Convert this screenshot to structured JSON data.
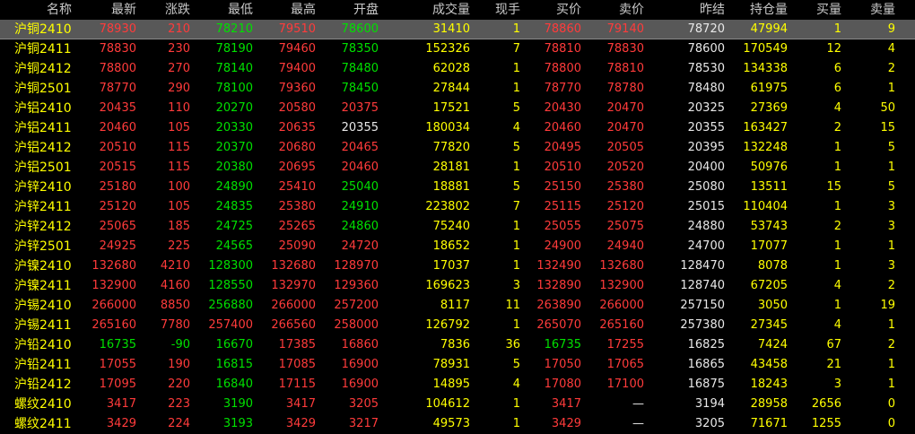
{
  "columns": [
    "名称",
    "最新",
    "涨跌",
    "最低",
    "最高",
    "开盘",
    "成交量",
    "现手",
    "买价",
    "卖价",
    "昨结",
    "持仓量",
    "买量",
    "卖量"
  ],
  "colors": {
    "up": "#ff3b3b",
    "down": "#00e000",
    "name": "#ffff00",
    "neutral": "#e8e8e8",
    "header": "#c8c8c8",
    "selected_row": "#585858"
  },
  "selected_row_index": 0,
  "rows": [
    {
      "name": "沪铜2410",
      "last": "78930",
      "chg": "210",
      "low": "78210",
      "high": "79510",
      "open": "78600",
      "vol": "31410",
      "curvol": "1",
      "bid": "78860",
      "ask": "79140",
      "prev": "78720",
      "oi": "47994",
      "bidvol": "1",
      "askvol": "9"
    },
    {
      "name": "沪铜2411",
      "last": "78830",
      "chg": "230",
      "low": "78190",
      "high": "79460",
      "open": "78350",
      "vol": "152326",
      "curvol": "7",
      "bid": "78810",
      "ask": "78830",
      "prev": "78600",
      "oi": "170549",
      "bidvol": "12",
      "askvol": "4"
    },
    {
      "name": "沪铜2412",
      "last": "78800",
      "chg": "270",
      "low": "78140",
      "high": "79400",
      "open": "78480",
      "vol": "62028",
      "curvol": "1",
      "bid": "78800",
      "ask": "78810",
      "prev": "78530",
      "oi": "134338",
      "bidvol": "6",
      "askvol": "2"
    },
    {
      "name": "沪铜2501",
      "last": "78770",
      "chg": "290",
      "low": "78100",
      "high": "79360",
      "open": "78450",
      "vol": "27844",
      "curvol": "1",
      "bid": "78770",
      "ask": "78780",
      "prev": "78480",
      "oi": "61975",
      "bidvol": "6",
      "askvol": "1"
    },
    {
      "name": "沪铝2410",
      "last": "20435",
      "chg": "110",
      "low": "20270",
      "high": "20580",
      "open": "20375",
      "vol": "17521",
      "curvol": "5",
      "bid": "20430",
      "ask": "20470",
      "prev": "20325",
      "oi": "27369",
      "bidvol": "4",
      "askvol": "50"
    },
    {
      "name": "沪铝2411",
      "last": "20460",
      "chg": "105",
      "low": "20330",
      "high": "20635",
      "open": "20355",
      "vol": "180034",
      "curvol": "4",
      "bid": "20460",
      "ask": "20470",
      "prev": "20355",
      "oi": "163427",
      "bidvol": "2",
      "askvol": "15"
    },
    {
      "name": "沪铝2412",
      "last": "20510",
      "chg": "115",
      "low": "20370",
      "high": "20680",
      "open": "20465",
      "vol": "77820",
      "curvol": "5",
      "bid": "20495",
      "ask": "20505",
      "prev": "20395",
      "oi": "132248",
      "bidvol": "1",
      "askvol": "5"
    },
    {
      "name": "沪铝2501",
      "last": "20515",
      "chg": "115",
      "low": "20380",
      "high": "20695",
      "open": "20460",
      "vol": "28181",
      "curvol": "1",
      "bid": "20510",
      "ask": "20520",
      "prev": "20400",
      "oi": "50976",
      "bidvol": "1",
      "askvol": "1"
    },
    {
      "name": "沪锌2410",
      "last": "25180",
      "chg": "100",
      "low": "24890",
      "high": "25410",
      "open": "25040",
      "vol": "18881",
      "curvol": "5",
      "bid": "25150",
      "ask": "25380",
      "prev": "25080",
      "oi": "13511",
      "bidvol": "15",
      "askvol": "5"
    },
    {
      "name": "沪锌2411",
      "last": "25120",
      "chg": "105",
      "low": "24835",
      "high": "25380",
      "open": "24910",
      "vol": "223802",
      "curvol": "7",
      "bid": "25115",
      "ask": "25120",
      "prev": "25015",
      "oi": "110404",
      "bidvol": "1",
      "askvol": "3"
    },
    {
      "name": "沪锌2412",
      "last": "25065",
      "chg": "185",
      "low": "24725",
      "high": "25265",
      "open": "24860",
      "vol": "75240",
      "curvol": "1",
      "bid": "25055",
      "ask": "25075",
      "prev": "24880",
      "oi": "53743",
      "bidvol": "2",
      "askvol": "3"
    },
    {
      "name": "沪锌2501",
      "last": "24925",
      "chg": "225",
      "low": "24565",
      "high": "25090",
      "open": "24720",
      "vol": "18652",
      "curvol": "1",
      "bid": "24900",
      "ask": "24940",
      "prev": "24700",
      "oi": "17077",
      "bidvol": "1",
      "askvol": "1"
    },
    {
      "name": "沪镍2410",
      "last": "132680",
      "chg": "4210",
      "low": "128300",
      "high": "132680",
      "open": "128970",
      "vol": "17037",
      "curvol": "1",
      "bid": "132490",
      "ask": "132680",
      "prev": "128470",
      "oi": "8078",
      "bidvol": "1",
      "askvol": "3"
    },
    {
      "name": "沪镍2411",
      "last": "132900",
      "chg": "4160",
      "low": "128550",
      "high": "132970",
      "open": "129360",
      "vol": "169623",
      "curvol": "3",
      "bid": "132890",
      "ask": "132900",
      "prev": "128740",
      "oi": "67205",
      "bidvol": "4",
      "askvol": "2"
    },
    {
      "name": "沪锡2410",
      "last": "266000",
      "chg": "8850",
      "low": "256880",
      "high": "266000",
      "open": "257200",
      "vol": "8117",
      "curvol": "11",
      "bid": "263890",
      "ask": "266000",
      "prev": "257150",
      "oi": "3050",
      "bidvol": "1",
      "askvol": "19"
    },
    {
      "name": "沪锡2411",
      "last": "265160",
      "chg": "7780",
      "low": "257400",
      "high": "266560",
      "open": "258000",
      "vol": "126792",
      "curvol": "1",
      "bid": "265070",
      "ask": "265160",
      "prev": "257380",
      "oi": "27345",
      "bidvol": "4",
      "askvol": "1"
    },
    {
      "name": "沪铅2410",
      "last": "16735",
      "chg": "-90",
      "low": "16670",
      "high": "17385",
      "open": "16860",
      "vol": "7836",
      "curvol": "36",
      "bid": "16735",
      "ask": "17255",
      "prev": "16825",
      "oi": "7424",
      "bidvol": "67",
      "askvol": "2"
    },
    {
      "name": "沪铅2411",
      "last": "17055",
      "chg": "190",
      "low": "16815",
      "high": "17085",
      "open": "16900",
      "vol": "78931",
      "curvol": "5",
      "bid": "17050",
      "ask": "17065",
      "prev": "16865",
      "oi": "43458",
      "bidvol": "21",
      "askvol": "1"
    },
    {
      "name": "沪铅2412",
      "last": "17095",
      "chg": "220",
      "low": "16840",
      "high": "17115",
      "open": "16900",
      "vol": "14895",
      "curvol": "4",
      "bid": "17080",
      "ask": "17100",
      "prev": "16875",
      "oi": "18243",
      "bidvol": "3",
      "askvol": "1"
    },
    {
      "name": "螺纹2410",
      "last": "3417",
      "chg": "223",
      "low": "3190",
      "high": "3417",
      "open": "3205",
      "vol": "104612",
      "curvol": "1",
      "bid": "3417",
      "ask": "—",
      "prev": "3194",
      "oi": "28958",
      "bidvol": "2656",
      "askvol": "0"
    },
    {
      "name": "螺纹2411",
      "last": "3429",
      "chg": "224",
      "low": "3193",
      "high": "3429",
      "open": "3217",
      "vol": "49573",
      "curvol": "1",
      "bid": "3429",
      "ask": "—",
      "prev": "3205",
      "oi": "71671",
      "bidvol": "1255",
      "askvol": "0"
    }
  ]
}
